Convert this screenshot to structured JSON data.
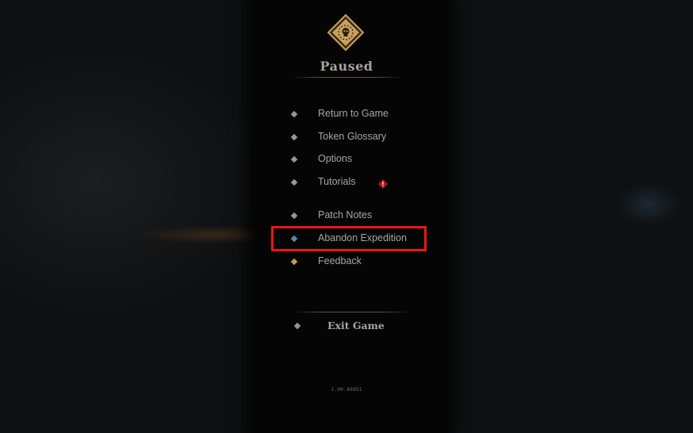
{
  "pause_menu": {
    "title": "Paused",
    "crest_icon": "skull-sun-crest-icon",
    "items": [
      {
        "label": "Return to Game",
        "bullet_color": "#9a9590"
      },
      {
        "label": "Token Glossary",
        "bullet_color": "#9a9590"
      },
      {
        "label": "Options",
        "bullet_color": "#9a9590"
      },
      {
        "label": "Tutorials",
        "bullet_color": "#9a9590",
        "badge": "!"
      },
      {
        "label": "Patch Notes",
        "bullet_color": "#9a9590"
      },
      {
        "label": "Abandon Expedition",
        "bullet_color": "#4d8fb1",
        "highlighted": true
      },
      {
        "label": "Feedback",
        "bullet_color": "#c49a5b"
      }
    ],
    "exit_label": "Exit Game",
    "version": "1.00.49951"
  },
  "colors": {
    "highlight_box": "#ee1414",
    "text": "#aaa59f",
    "alert": "#b3141c",
    "crest_gold": "#c9a15e"
  }
}
